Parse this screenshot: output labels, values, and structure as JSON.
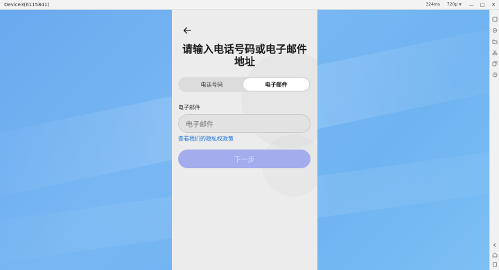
{
  "window": {
    "title": "Device3(6115841)",
    "latency": "324ms",
    "resolution": "720p",
    "controls": [
      "—",
      "□",
      "✕"
    ]
  },
  "phone": {
    "back_icon": "arrow-left-icon",
    "heading": "请输入电话号码或电子邮件地址",
    "tabs": [
      {
        "label": "电话号码",
        "active": false
      },
      {
        "label": "电子邮件",
        "active": true
      }
    ],
    "field_label": "电子邮件",
    "email_input": {
      "value": "",
      "placeholder": "电子邮件"
    },
    "privacy_link": "查看我们的隐私权政策",
    "next_button": "下一步"
  },
  "sidebar": {
    "tools": [
      "settings-icon",
      "gear-icon",
      "folder-icon",
      "scissors-icon",
      "copy-icon",
      "history-icon",
      "back-icon",
      "home-icon",
      "recent-apps-icon"
    ]
  },
  "colors": {
    "desktop": "#6fb3f1",
    "link": "#1b6fd8",
    "button_disabled": "#a3acec"
  }
}
